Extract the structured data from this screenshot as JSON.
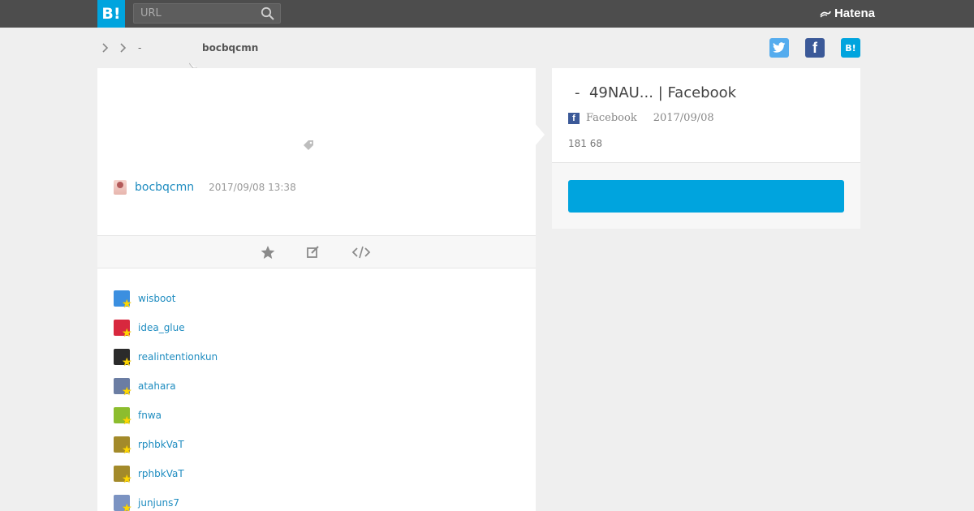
{
  "header": {
    "logo_label": "B!",
    "search_placeholder": "URL",
    "brand": "Hatena"
  },
  "breadcrumb": {
    "dash": "-",
    "user": "bocbqcmn"
  },
  "comment": {
    "user": "bocbqcmn",
    "date": "2017/09/08 13:38"
  },
  "stars": [
    {
      "name": "wisboot",
      "icon": "avatar-311",
      "color": "#3b8fe0"
    },
    {
      "name": "idea_glue",
      "icon": "avatar-flower",
      "color": "#d8283e"
    },
    {
      "name": "realintentionkun",
      "icon": "avatar-portrait",
      "color": "#2b2b2b"
    },
    {
      "name": "atahara",
      "icon": "avatar-scene",
      "color": "#6b7da3"
    },
    {
      "name": "fnwa",
      "icon": "avatar-banner",
      "color": "#8cbd2e"
    },
    {
      "name": "rphbkVaT",
      "icon": "avatar-figure",
      "color": "#a38a2a"
    },
    {
      "name": "rphbkVaT",
      "icon": "avatar-figure",
      "color": "#a38a2a"
    },
    {
      "name": "junjuns7",
      "icon": "avatar-person",
      "color": "#7b93c2"
    }
  ],
  "entry": {
    "dash": "-",
    "title": "49NAU... | Facebook",
    "site": "Facebook",
    "date": "2017/09/08",
    "counts": "181 68",
    "bookmark_button_label": ""
  },
  "share": {
    "twitter_icon": "twitter-icon",
    "facebook_icon": "facebook-icon",
    "hatena_icon": "hatena-bookmark-icon",
    "facebook_letter": "f",
    "hatena_letter": "B!"
  }
}
